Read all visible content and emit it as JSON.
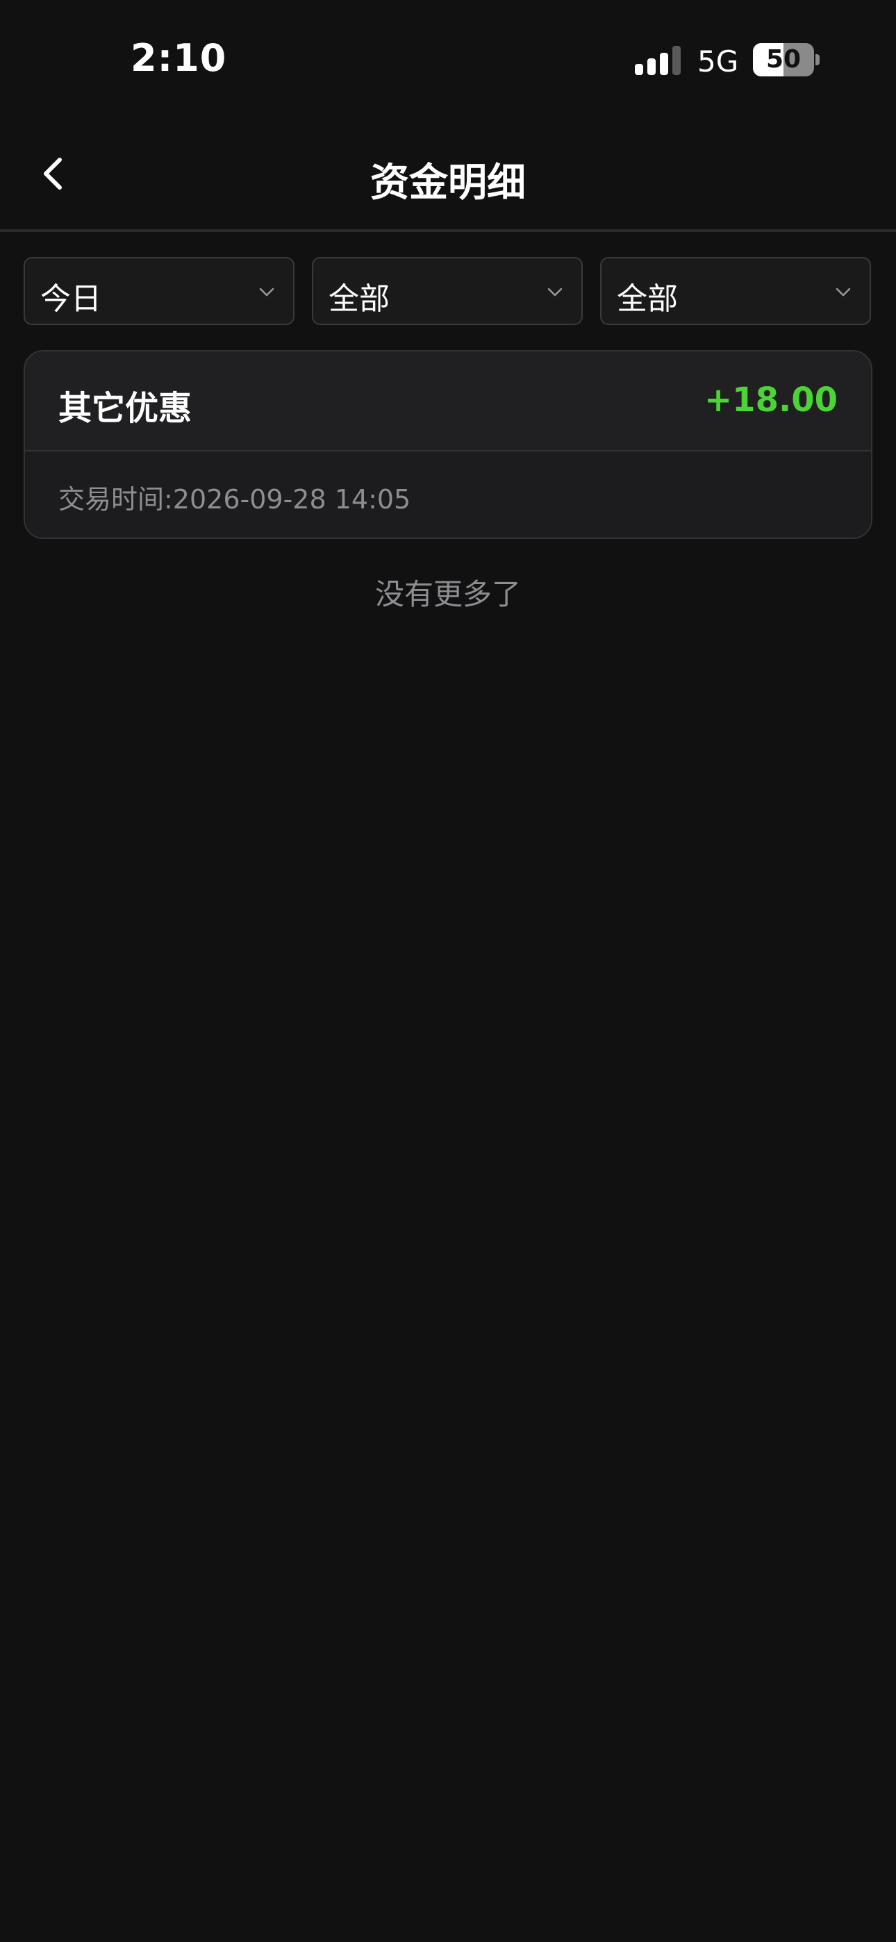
{
  "status_bar": {
    "time": "2:10",
    "network": "5G",
    "battery_level": "50",
    "signal_bars_active": 3,
    "signal_bars_total": 4
  },
  "nav": {
    "title": "资金明细",
    "back_icon": "chevron-left-icon"
  },
  "filters": [
    {
      "label": "今日",
      "icon": "chevron-down-icon"
    },
    {
      "label": "全部",
      "icon": "chevron-down-icon"
    },
    {
      "label": "全部",
      "icon": "chevron-down-icon"
    }
  ],
  "transactions": [
    {
      "title": "其它优惠",
      "amount": "+18.00",
      "time_label": "交易时间:2026-09-28 14:05"
    }
  ],
  "list_end_text": "没有更多了",
  "colors": {
    "background": "#111111",
    "card": "#1c1c1e",
    "positive_amount": "#4cd335",
    "secondary_text": "#8d8d92"
  }
}
